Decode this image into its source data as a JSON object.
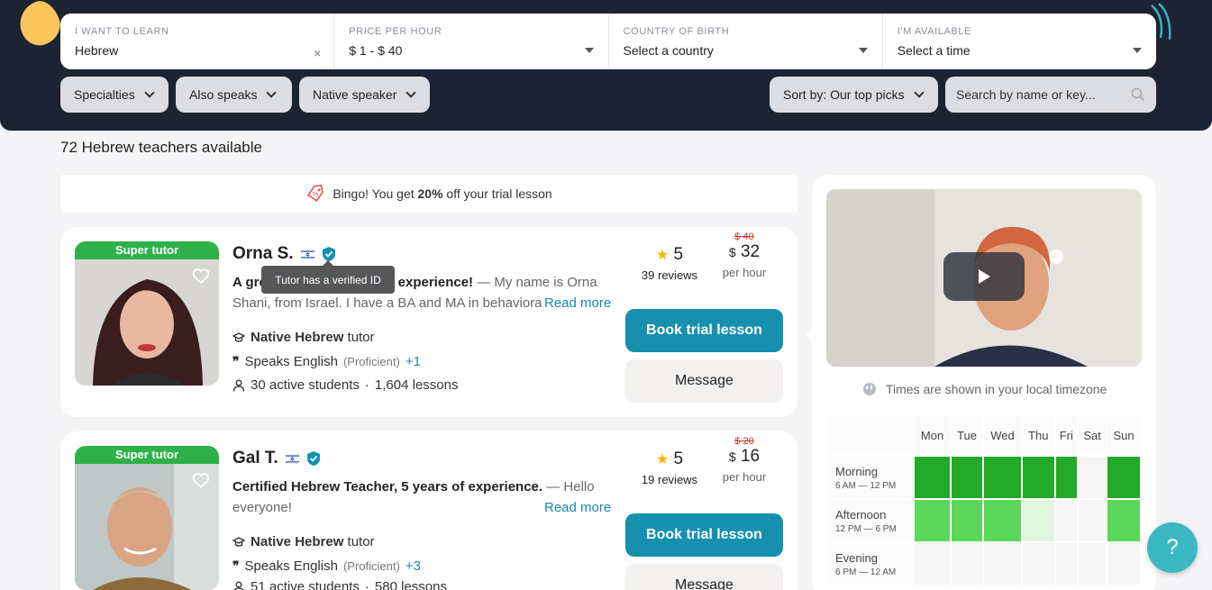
{
  "filters": {
    "learn": {
      "label": "I want to learn",
      "value": "Hebrew",
      "clear": "×"
    },
    "price": {
      "label": "Price per hour",
      "value": "$ 1 - $ 40"
    },
    "country": {
      "label": "Country of birth",
      "value": "Select a country"
    },
    "available": {
      "label": "I'm available",
      "value": "Select a time"
    }
  },
  "pills": {
    "specialties": "Specialties",
    "also_speaks": "Also speaks",
    "native_speaker": "Native speaker",
    "sort": "Sort by: Our top picks"
  },
  "search": {
    "placeholder": "Search by name or key..."
  },
  "results_title": "72 Hebrew teachers available",
  "promo": {
    "before": "Bingo! You get ",
    "bold": "20%",
    "after": " off your trial lesson"
  },
  "tooltip": "Tutor has a verified ID",
  "tutors": [
    {
      "badge": "Super tutor",
      "name": "Orna S.",
      "headline_bold": "A great tutor with 4 years experience!",
      "headline_rest": " — My name is Orna Shani, from Israel. I have a BA and MA in behavioral",
      "read_more": "Read more",
      "native_label": "Native Hebrew",
      "native_suffix": " tutor",
      "speaks_label": "Speaks English",
      "speaks_level": "(Proficient)",
      "speaks_more": "+1",
      "students": "30 active students",
      "dot": "·",
      "lessons": "1,604 lessons",
      "rating": "5",
      "reviews": "39 reviews",
      "old_price": "$ 40",
      "currency": "$",
      "price": "32",
      "per_hour": "per hour",
      "book": "Book trial lesson",
      "message": "Message"
    },
    {
      "badge": "Super tutor",
      "name": "Gal T.",
      "headline_bold": "Certified Hebrew Teacher, 5 years of experience.",
      "headline_rest": " — Hello everyone!",
      "read_more": "Read more",
      "native_label": "Native Hebrew",
      "native_suffix": " tutor",
      "speaks_label": "Speaks English",
      "speaks_level": "(Proficient)",
      "speaks_more": "+3",
      "students": "51 active students",
      "dot": "·",
      "lessons": "580 lessons",
      "rating": "5",
      "reviews": "19 reviews",
      "old_price": "$ 20",
      "currency": "$",
      "price": "16",
      "per_hour": "per hour",
      "book": "Book trial lesson",
      "message": "Message"
    }
  ],
  "schedule": {
    "timezone_note": "Times are shown in your local timezone",
    "days": [
      "Mon",
      "Tue",
      "Wed",
      "Thu",
      "Fri",
      "Sat",
      "Sun"
    ],
    "rows": [
      {
        "label": "Morning",
        "range": "6 AM — 12 PM",
        "levels": [
          3,
          3,
          3,
          3,
          3,
          0,
          3
        ]
      },
      {
        "label": "Afternoon",
        "range": "12 PM — 6 PM",
        "levels": [
          2,
          2,
          2,
          1,
          0,
          0,
          2
        ]
      },
      {
        "label": "Evening",
        "range": "6 PM — 12 AM",
        "levels": [
          0,
          0,
          0,
          0,
          0,
          0,
          0
        ]
      }
    ]
  },
  "help_label": "?"
}
